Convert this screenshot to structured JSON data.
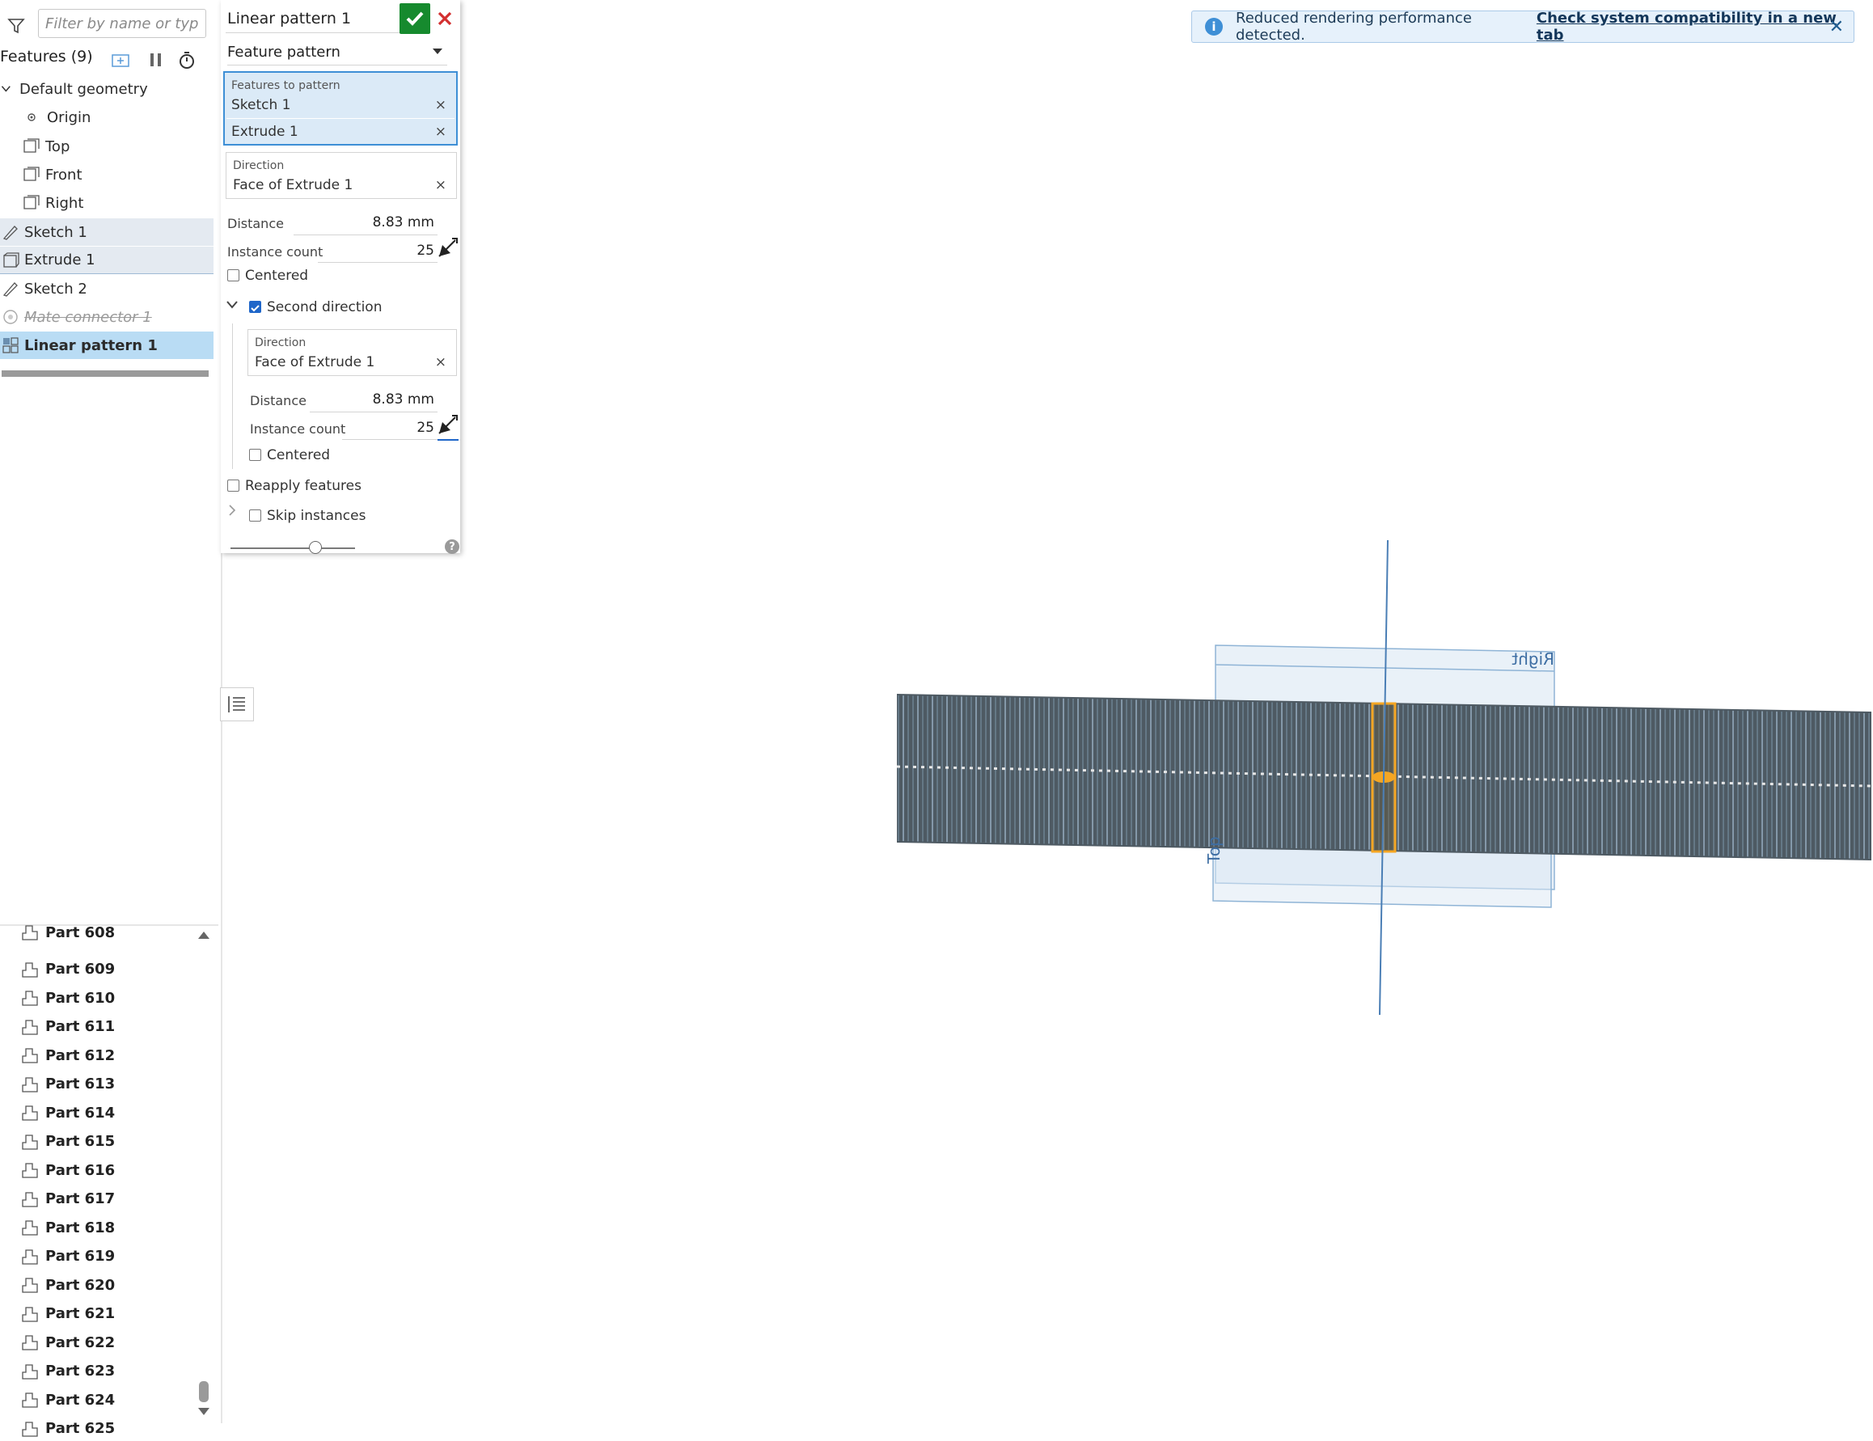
{
  "filter": {
    "placeholder": "Filter by name or type"
  },
  "features_header": "Features (9)",
  "tree": {
    "default_geometry": "Default geometry",
    "origin": "Origin",
    "top": "Top",
    "front": "Front",
    "right": "Right",
    "sketch1": "Sketch 1",
    "extrude1": "Extrude 1",
    "sketch2": "Sketch 2",
    "mate_connector": "Mate connector 1",
    "linear_pattern": "Linear pattern 1"
  },
  "parts": [
    "Part 608",
    "Part 609",
    "Part 610",
    "Part 611",
    "Part 612",
    "Part 613",
    "Part 614",
    "Part 615",
    "Part 616",
    "Part 617",
    "Part 618",
    "Part 619",
    "Part 620",
    "Part 621",
    "Part 622",
    "Part 623",
    "Part 624",
    "Part 625"
  ],
  "dialog": {
    "title": "Linear pattern 1",
    "pattern_type": "Feature pattern",
    "features_label": "Features to pattern",
    "feature_items": [
      "Sketch 1",
      "Extrude 1"
    ],
    "direction_label": "Direction",
    "direction_value": "Face of Extrude 1",
    "distance_label": "Distance",
    "distance_value": "8.83 mm",
    "count_label": "Instance count",
    "count_value": "25",
    "centered_label": "Centered",
    "second_direction_label": "Second direction",
    "second": {
      "direction_label": "Direction",
      "direction_value": "Face of Extrude 1",
      "distance_label": "Distance",
      "distance_value": "8.83 mm",
      "count_label": "Instance count",
      "count_value": "25",
      "centered_label": "Centered"
    },
    "reapply_label": "Reapply features",
    "skip_label": "Skip instances",
    "remove_glyph": "×",
    "help_glyph": "?"
  },
  "banner": {
    "message": "Reduced rendering performance detected.",
    "link": "Check system compatibility in a new tab",
    "info_glyph": "i",
    "close_glyph": "✕"
  },
  "viewport": {
    "plane_right": "Right",
    "plane_top": "Top"
  },
  "colors": {
    "accent": "#3e8fd6",
    "ok": "#168a2e",
    "cancel": "#d32f2f",
    "selection": "#f5a623"
  }
}
